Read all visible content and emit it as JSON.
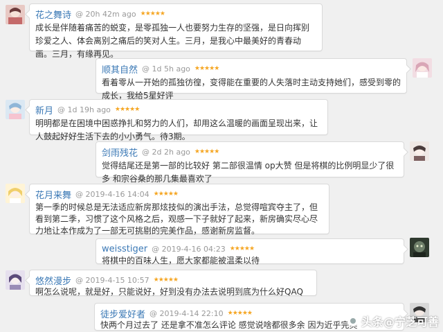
{
  "comments": [
    {
      "user": "花之舞诗",
      "meta": "@ 20h 42m ago",
      "stars": "★★★★★",
      "text": "成长是伴随着痛苦的蜕变，是零孤独一人也要努力生存的坚强，是日向挥别珍爱之人、体会离别之痛后的笑对人生。三月，是我心中最美好的青春动画。三月，有缘再见。"
    },
    {
      "user": "顺其自然",
      "meta": "@ 1d 5h ago",
      "stars": "★★★★★",
      "text": "看着零从一开始的孤独彷徨，变得能在重要的人失落时主动支持她们，感受到零的成长，我给5星好评"
    },
    {
      "user": "新月",
      "meta": "@ 1d 19h ago",
      "stars": "★★★★★",
      "text": "明明都是在困境中困惑挣扎和努力的人们，却用这么温暖的画面呈现出来，让人鼓起好好生活下去的小小勇气。待3期。"
    },
    {
      "user": "剑雨残花",
      "meta": "@ 2d 2h ago",
      "stars": "★★★★★",
      "text": "觉得结尾还是第一部的比较好 第二部很温情 op大赞 但是将棋的比例明显少了很多 和宗谷桑的那几集最喜欢了"
    },
    {
      "user": "花月来舞",
      "meta": "@ 2019-4-16 14:04",
      "stars": "★★★★★",
      "text": "第一季的时候总是无法适应新房那炫技似的演出手法，总觉得喧宾夺主了，但看到第二季，习惯了这个风格之后，观感一下子就好了起来，新房确实尽心尽力地让本作成为了一部无可挑剔的完美作品，感谢新房监督。"
    },
    {
      "user": "weisstiger",
      "meta": "@ 2019-4-16 04:23",
      "stars": "★★★★★",
      "text": "将棋中的百味人生，愿大家都能被温柔以待"
    },
    {
      "user": "悠然漫步",
      "meta": "@ 2019-4-15 10:57",
      "stars": "★★★★★",
      "text": "啊怎么说呢，就是好，只能说好，好到没有办法去说明到底为什么好QAQ"
    },
    {
      "user": "徒步爱好者",
      "meta": "@ 2019-4-14 22:10",
      "stars": "★★★★★",
      "text": "快两个月过去了 还是拿不准怎么评论 感觉说啥都很多余 因为近乎完美"
    }
  ],
  "watermark": "头条@宁芝可善",
  "colors": {
    "username": "#3a78b5",
    "meta": "#999999",
    "stars": "#f5a623",
    "text": "#333333",
    "background": "#f0f0f0"
  }
}
